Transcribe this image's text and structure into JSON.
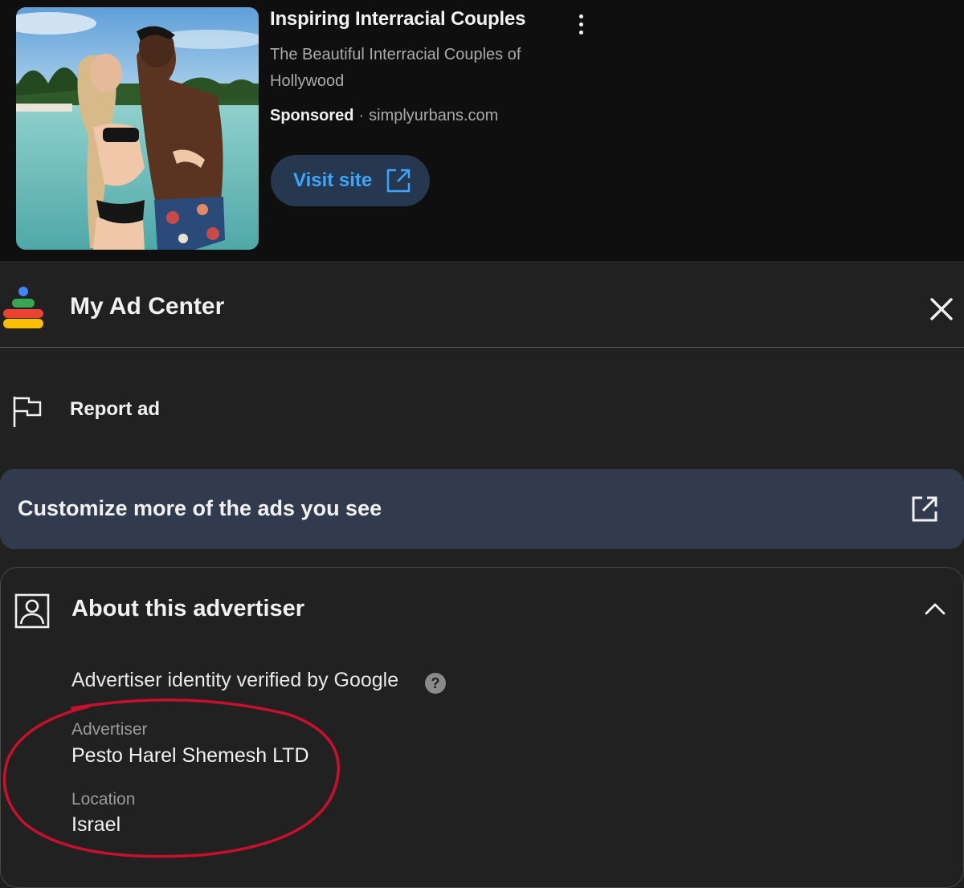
{
  "ad": {
    "title": "Inspiring Interracial Couples",
    "description": "The Beautiful Interracial Couples of Hollywood",
    "sponsored_label": "Sponsored",
    "separator": "·",
    "domain": "simplyurbans.com",
    "visit_button_label": "Visit site",
    "thumbnail_icon": "photo-couple-on-beach",
    "more_icon": "more-vert-icon"
  },
  "ad_center": {
    "title": "My Ad Center",
    "logo_icon": "my-ad-center-logo",
    "close_icon": "close-icon",
    "report_label": "Report ad",
    "report_icon": "flag-icon",
    "customize_label": "Customize more of the ads you see",
    "customize_icon": "open-in-new-icon",
    "about": {
      "title": "About this advertiser",
      "icon": "person-icon",
      "expanded": true,
      "verified_text": "Advertiser identity verified by Google",
      "advertiser_label": "Advertiser",
      "advertiser_value": "Pesto Harel Shemesh LTD",
      "location_label": "Location",
      "location_value": "Israel"
    }
  },
  "colors": {
    "background": "#212121",
    "ad_background": "#0f0f0f",
    "visit_button_bg": "#263850",
    "visit_button_text": "#3ea6ff",
    "customize_bg": "#323b4d",
    "highlight": "#c8102e"
  }
}
